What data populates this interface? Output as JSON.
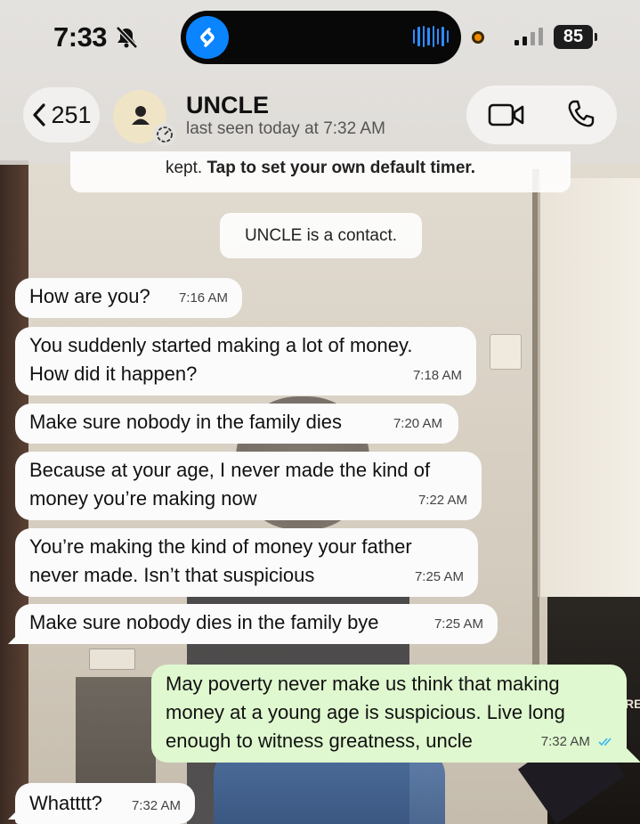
{
  "status_bar": {
    "time": "7:33",
    "battery": "85"
  },
  "header": {
    "back_count": "251",
    "contact_name": "UNCLE",
    "last_seen": "last seen today at 7:32 AM"
  },
  "system_messages": {
    "timer_plain": "kept. ",
    "timer_bold": "Tap to set your own default timer.",
    "contact_notice": "UNCLE is a contact."
  },
  "messages": [
    {
      "text": "How are you?",
      "time": "7:16 AM"
    },
    {
      "text": "You suddenly started making a lot of money. How did it happen?",
      "time": "7:18 AM"
    },
    {
      "text": "Make sure nobody in the family dies",
      "time": "7:20 AM"
    },
    {
      "text": "Because at your age, I never made the kind of money you’re making now",
      "time": "7:22 AM"
    },
    {
      "text": "You’re making the kind of money your father never made. Isn’t that suspicious",
      "time": "7:25 AM"
    },
    {
      "text": "Make sure nobody dies in the family bye",
      "time": "7:25 AM"
    },
    {
      "text": "May poverty never make us think that making money at a young age is suspicious. Live long enough to witness greatness, uncle",
      "time": "7:32 AM"
    },
    {
      "text": "Whatttt?",
      "time": "7:32 AM"
    }
  ],
  "wallpaper": {
    "cabinet_label": "RE"
  },
  "colors": {
    "incoming_bubble": "#fbfbfb",
    "outgoing_bubble": "#dff8cf",
    "read_ticks": "#34b7f1",
    "shazam": "#0a84ff"
  },
  "icons": [
    "bell-off-icon",
    "shazam-icon",
    "audio-wave-icon",
    "signal-icon",
    "battery-icon",
    "back-chevron-icon",
    "person-icon",
    "timer-icon",
    "video-call-icon",
    "phone-icon",
    "double-check-icon"
  ]
}
